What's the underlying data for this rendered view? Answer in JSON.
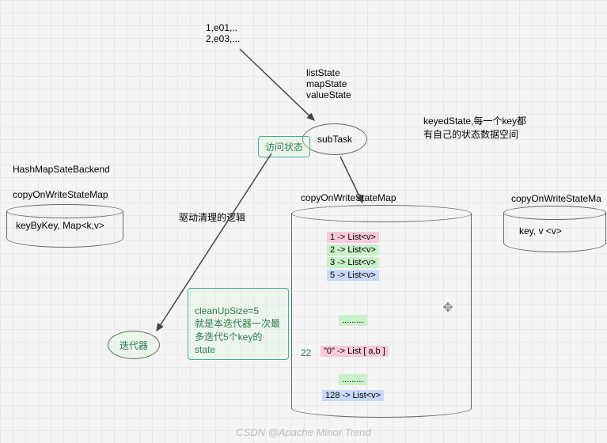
{
  "inputData": "1,e01,..\n2,e03,...",
  "states": "listState\nmapState\nvalueState",
  "visitState": "访问状态",
  "subTask": "subTask",
  "keyedState": "keyedState,每一个key都\n有自己的状态数据空间",
  "backend": "HashMapSateBackend",
  "leftMapTitle": "copyOnWriteStateMap",
  "leftMapContent": "keyByKey,   Map<k,v>",
  "driveLogic": "驱动清理的逻辑",
  "iterator": "迭代器",
  "cleanup": "cleanUpSize=5\n就是本迭代器一次最\n多迭代5个key的state",
  "centerMapTitle": "copyOnWriteStateMap",
  "entries": {
    "e1": "1  ->   List<v>",
    "e2": "2  ->   List<v>",
    "e3": "3  ->   List<v>",
    "e5": "5  ->   List<v>",
    "dots1": ".........",
    "num22": "22",
    "e0": "\"0\"   ->    List [ a,b ]",
    "dots2": ".........",
    "e128": "128  ->   List<v>"
  },
  "rightMapTitle": "copyOnWriteStateMa",
  "rightMapContent": "key,   v <v>",
  "watermark": "CSDN @Apache Minor Trend"
}
